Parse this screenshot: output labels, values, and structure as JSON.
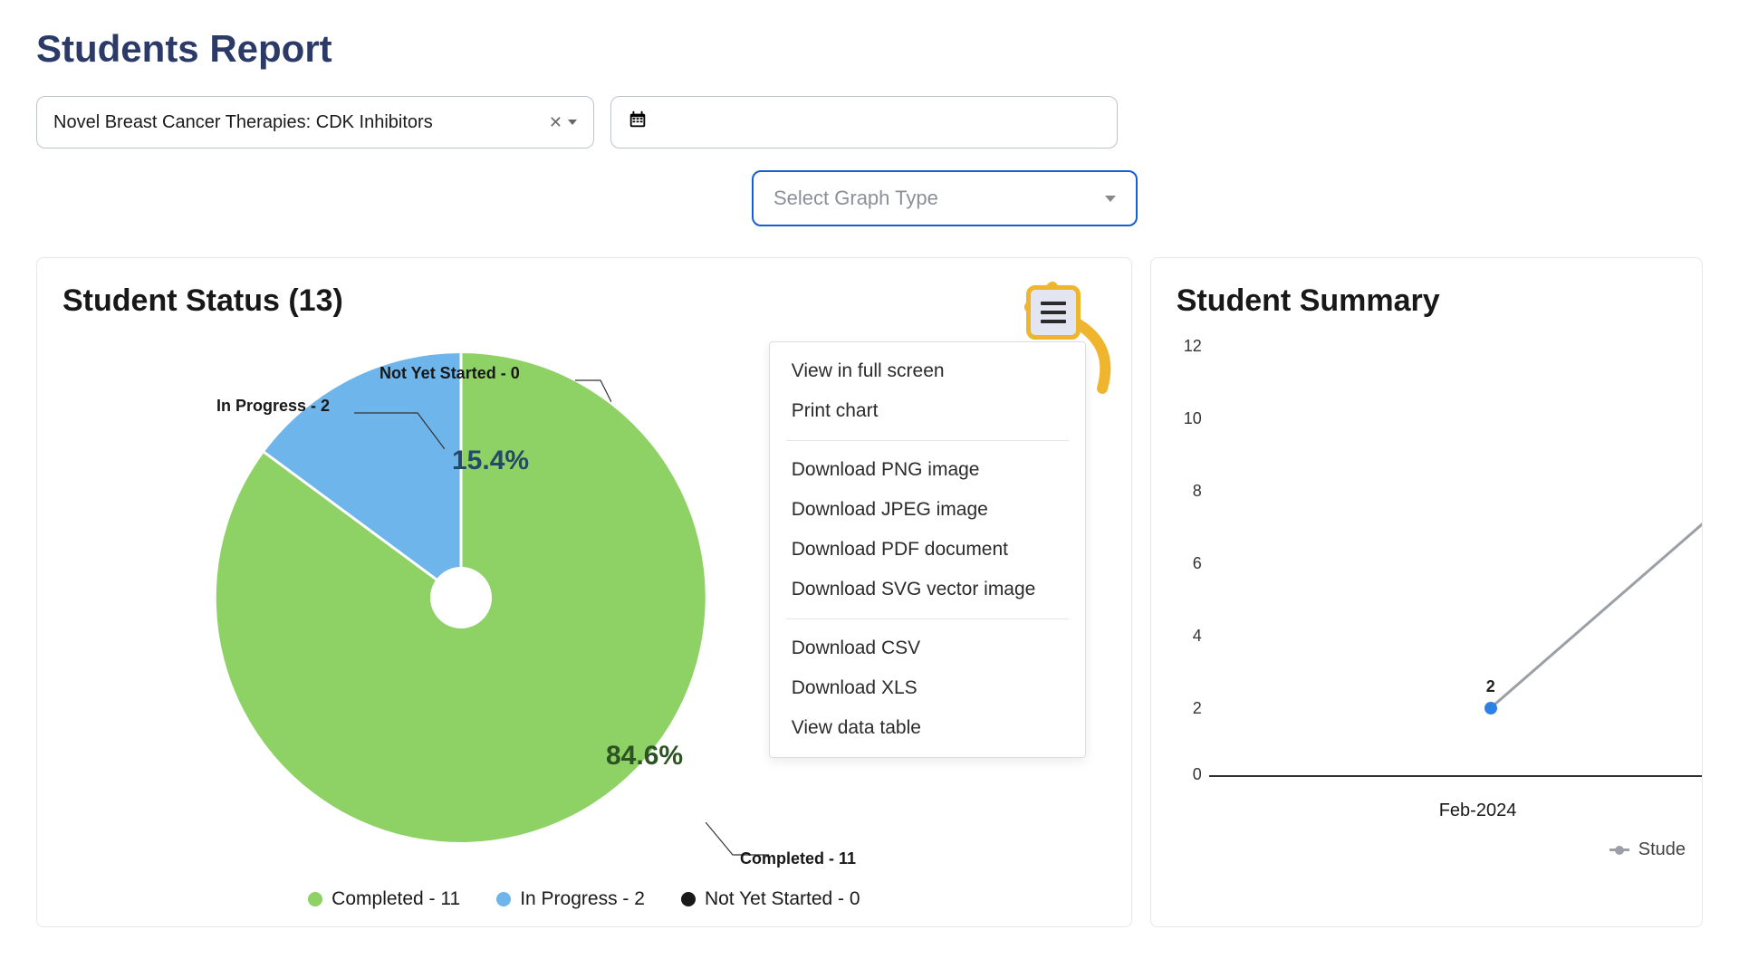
{
  "page_title": "Students Report",
  "filters": {
    "course_label": "Novel Breast Cancer Therapies: CDK Inhibitors",
    "graph_type_placeholder": "Select Graph Type"
  },
  "pie": {
    "title": "Student Status (13)",
    "labels": {
      "not_started": "Not Yet Started - 0",
      "in_progress": "In Progress - 2",
      "completed": "Completed - 11"
    },
    "pct": {
      "in_progress": "15.4%",
      "completed": "84.6%"
    },
    "legend": {
      "completed": "Completed - 11",
      "in_progress": "In Progress - 2",
      "not_started": "Not Yet Started - 0"
    }
  },
  "export_menu": {
    "view_full": "View in full screen",
    "print": "Print chart",
    "png": "Download PNG image",
    "jpeg": "Download JPEG image",
    "pdf": "Download PDF document",
    "svg": "Download SVG vector image",
    "csv": "Download CSV",
    "xls": "Download XLS",
    "table": "View data table"
  },
  "line": {
    "title": "Student Summary",
    "y_ticks": {
      "t12": "12",
      "t10": "10",
      "t8": "8",
      "t6": "6",
      "t4": "4",
      "t2": "2",
      "t0": "0"
    },
    "x_ticks": {
      "feb": "Feb-2024"
    },
    "point_label": "2",
    "legend_label": "Stude"
  },
  "chart_data": [
    {
      "type": "pie",
      "title": "Student Status (13)",
      "series": [
        {
          "name": "Completed",
          "value": 11,
          "pct": 84.6,
          "color": "#8ed165"
        },
        {
          "name": "In Progress",
          "value": 2,
          "pct": 15.4,
          "color": "#6db5eb"
        },
        {
          "name": "Not Yet Started",
          "value": 0,
          "pct": 0.0,
          "color": "#1a1a1a"
        }
      ],
      "total": 13
    },
    {
      "type": "line",
      "title": "Student Summary",
      "categories": [
        "Feb-2024"
      ],
      "series": [
        {
          "name": "Students",
          "values": [
            2
          ]
        }
      ],
      "ylim": [
        0,
        12
      ],
      "ylabel": "",
      "xlabel": ""
    }
  ]
}
